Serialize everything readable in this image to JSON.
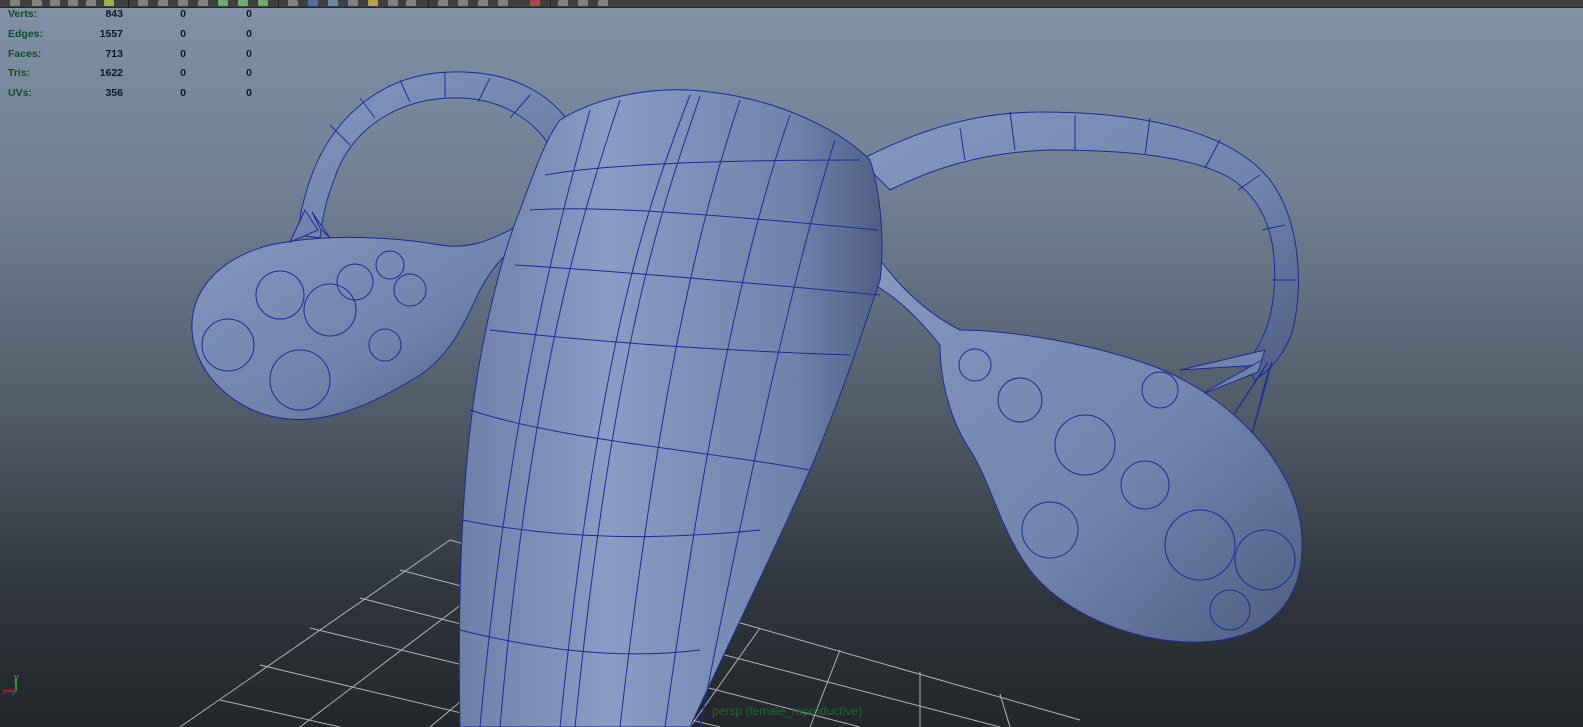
{
  "viewport": {
    "camera_label": "persp (female_reproductive)",
    "background_top": "#8192a7",
    "background_bottom": "#23272b",
    "mesh_color": "#7489b0",
    "wire_color": "#1a2b9a"
  },
  "hud": {
    "rows": [
      {
        "label": "Verts:",
        "v1": "843",
        "v2": "0",
        "v3": "0"
      },
      {
        "label": "Edges:",
        "v1": "1557",
        "v2": "0",
        "v3": "0"
      },
      {
        "label": "Faces:",
        "v1": "713",
        "v2": "0",
        "v3": "0"
      },
      {
        "label": "Tris:",
        "v1": "1622",
        "v2": "0",
        "v3": "0"
      },
      {
        "label": "UVs:",
        "v1": "356",
        "v2": "0",
        "v3": "0"
      }
    ]
  },
  "axis_gizmo": {
    "x_label": "x",
    "y_label": "y",
    "x_color": "#d42020",
    "y_color": "#30c030",
    "z_color": "#2040e0"
  },
  "toolbar": {
    "icons": [
      "select-tool-icon",
      "lasso-icon",
      "paint-icon",
      "move-icon",
      "snap-icon",
      "render-icon",
      "layout-icon",
      "layout-icon",
      "layout-icon",
      "layout-icon",
      "layout-icon",
      "layout-icon",
      "shading-icon",
      "wireframe-icon",
      "texture-icon",
      "light-icon",
      "shadow-icon",
      "camera-icon",
      "isolate-icon",
      "xray-icon",
      "grid-icon"
    ]
  }
}
